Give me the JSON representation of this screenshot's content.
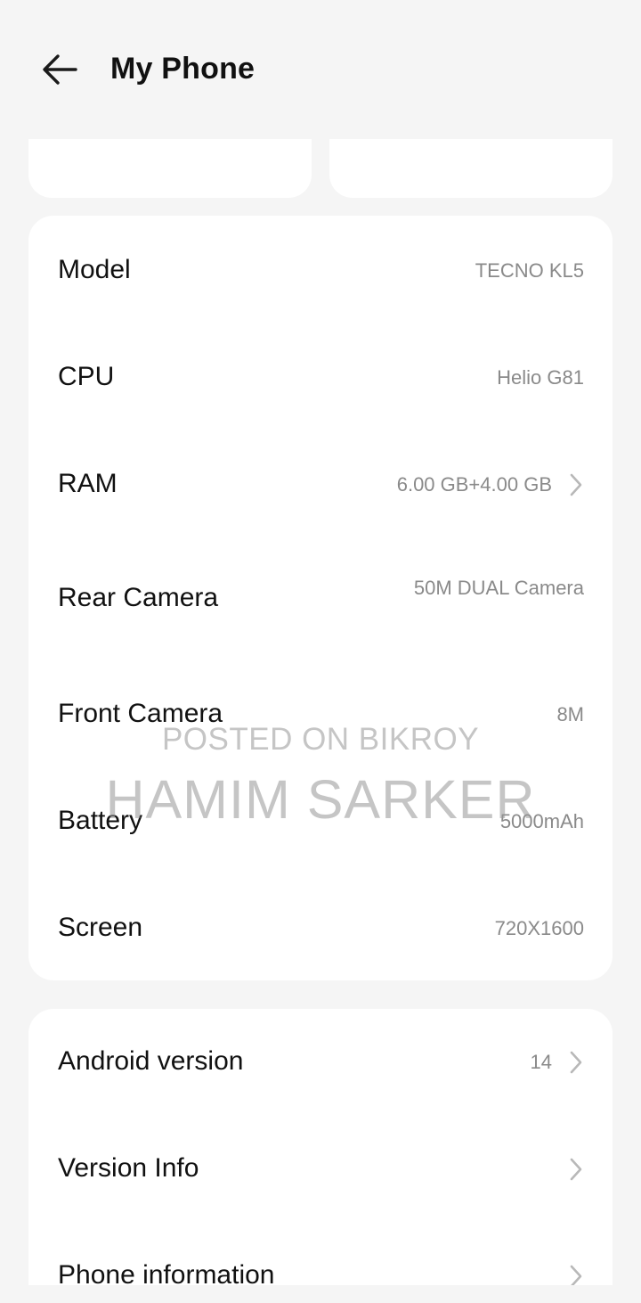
{
  "header": {
    "title": "My Phone"
  },
  "specs": [
    {
      "label": "Model",
      "value": "TECNO KL5"
    },
    {
      "label": "CPU",
      "value": "Helio G81"
    },
    {
      "label": "RAM",
      "value": "6.00 GB+4.00 GB"
    },
    {
      "label": "Rear Camera",
      "value": "50M DUAL Camera"
    },
    {
      "label": "Front Camera",
      "value": "8M"
    },
    {
      "label": "Battery",
      "value": "5000mAh"
    },
    {
      "label": "Screen",
      "value": "720X1600"
    }
  ],
  "system": [
    {
      "label": "Android version",
      "value": "14"
    },
    {
      "label": "Version Info",
      "value": ""
    },
    {
      "label": "Phone information",
      "value": ""
    }
  ],
  "watermark": {
    "line1": "POSTED ON BIKROY",
    "line2": "HAMIM SARKER"
  }
}
